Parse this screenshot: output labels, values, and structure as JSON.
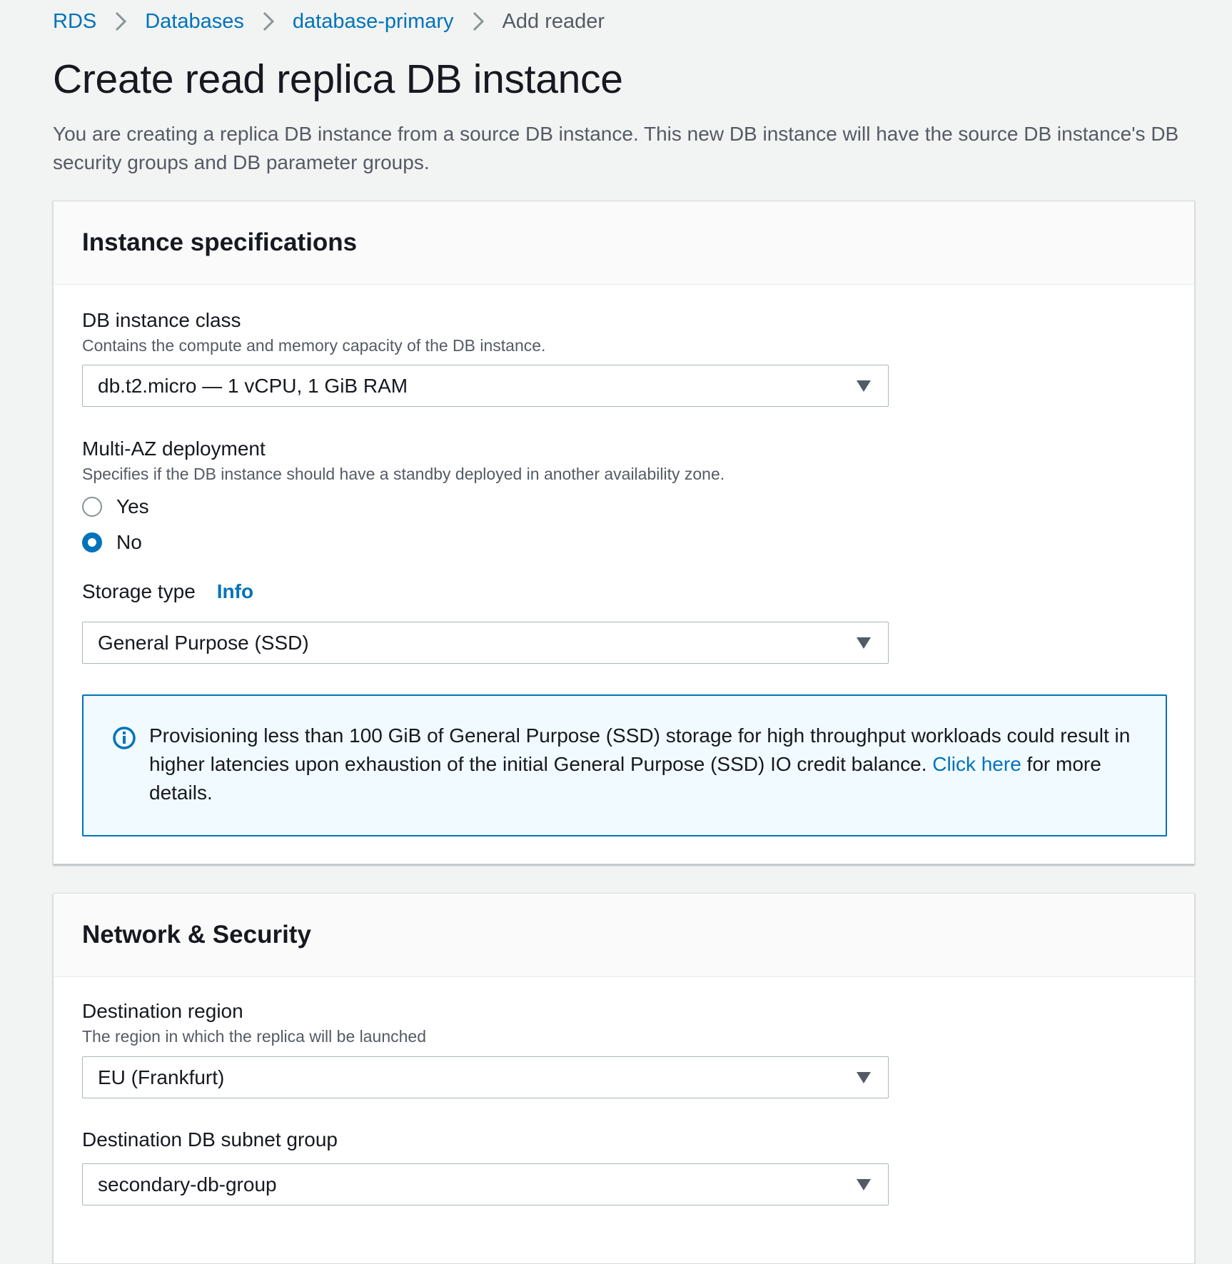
{
  "breadcrumb": {
    "items": [
      "RDS",
      "Databases",
      "database-primary"
    ],
    "current": "Add reader"
  },
  "page": {
    "title": "Create read replica DB instance",
    "description": "You are creating a replica DB instance from a source DB instance. This new DB instance will have the source DB instance's DB security groups and DB parameter groups."
  },
  "instance_specs": {
    "heading": "Instance specifications",
    "db_class": {
      "label": "DB instance class",
      "help": "Contains the compute and memory capacity of the DB instance.",
      "value": "db.t2.micro — 1 vCPU, 1 GiB RAM"
    },
    "multi_az": {
      "label": "Multi-AZ deployment",
      "help": "Specifies if the DB instance should have a standby deployed in another availability zone.",
      "options": [
        "Yes",
        "No"
      ],
      "selected": "No"
    },
    "storage": {
      "label": "Storage type",
      "info": "Info",
      "value": "General Purpose (SSD)"
    },
    "alert": {
      "text_before": "Provisioning less than 100 GiB of General Purpose (SSD) storage for high throughput workloads could result in higher latencies upon exhaustion of the initial General Purpose (SSD) IO credit balance. ",
      "link": "Click here",
      "text_after": " for more details."
    }
  },
  "network": {
    "heading": "Network & Security",
    "region": {
      "label": "Destination region",
      "help": "The region in which the replica will be launched",
      "value": "EU (Frankfurt)"
    },
    "subnet": {
      "label": "Destination DB subnet group",
      "value": "secondary-db-group"
    }
  },
  "colors": {
    "link": "#0073bb",
    "background": "#f2f3f3",
    "alert_bg": "#f1faff"
  },
  "icons": [
    "chevron-right-icon",
    "caret-down-icon",
    "info-circle-icon"
  ]
}
